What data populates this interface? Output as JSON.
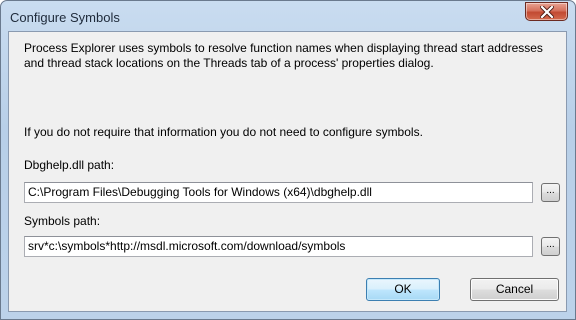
{
  "window": {
    "title": "Configure Symbols",
    "close_icon": "close-x-icon"
  },
  "content": {
    "description": "Process Explorer uses symbols to resolve function names when displaying thread start addresses and thread stack locations on the Threads tab of a process' properties dialog.",
    "note": "If you do not require that information you do not need to configure symbols.",
    "dbghelp": {
      "label": "Dbghelp.dll path:",
      "value": "C:\\Program Files\\Debugging Tools for Windows (x64)\\dbghelp.dll",
      "browse_label": "..."
    },
    "symbols": {
      "label": "Symbols path:",
      "value": "srv*c:\\symbols*http://msdl.microsoft.com/download/symbols",
      "browse_label": "..."
    }
  },
  "buttons": {
    "ok_label": "OK",
    "cancel_label": "Cancel"
  },
  "colors": {
    "frame": "#bcd2ea",
    "close_button": "#c24a32",
    "default_button_border": "#3c7fb1"
  }
}
